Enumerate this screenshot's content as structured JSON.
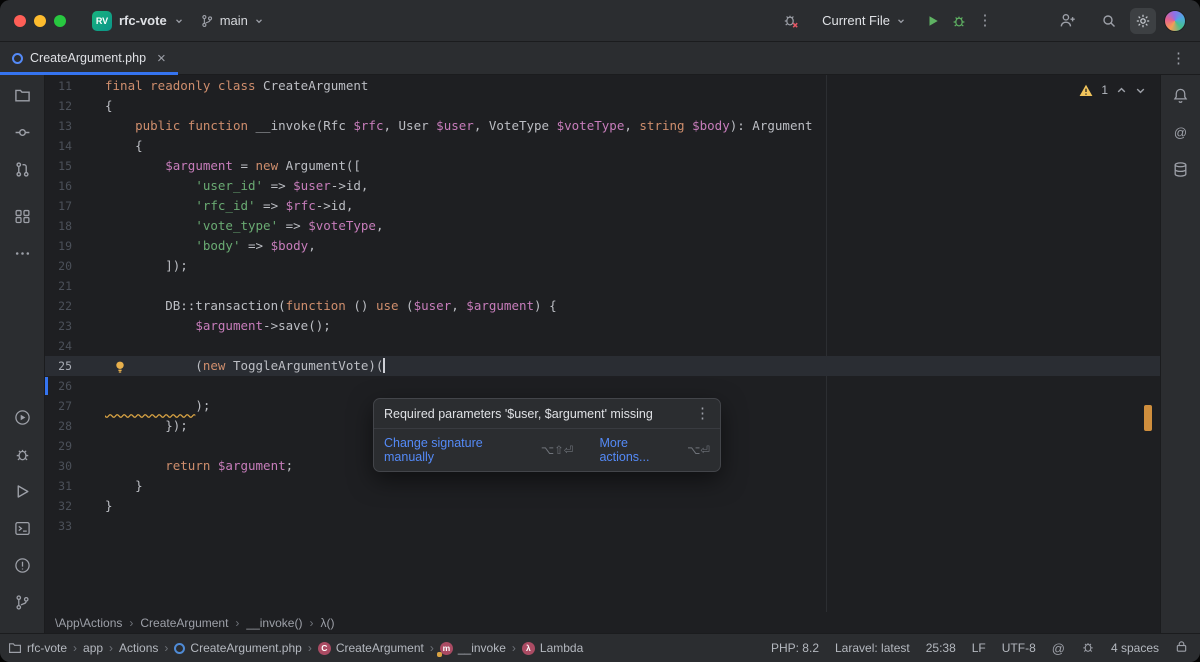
{
  "separator": "›",
  "icons": {
    "at": "@",
    "kebab": "⋮",
    "close": "×",
    "names": [
      "close-window-button",
      "minimize-window-button",
      "zoom-window-button",
      "project-logo",
      "chevron-down-icon",
      "git-branch-icon",
      "debugger-off-icon",
      "run-icon",
      "debug-icon",
      "more-vertical-icon",
      "add-user-icon",
      "search-icon",
      "gear-icon",
      "user-avatar",
      "php-file-icon",
      "bell-icon",
      "at-icon",
      "database-icon",
      "project-folder-icon",
      "commit-icon",
      "pull-request-icon",
      "structure-icon",
      "more-horizontal-icon",
      "run-circle-icon",
      "bug-icon",
      "services-icon",
      "terminal-icon",
      "problems-icon",
      "branch-icon",
      "warning-triangle-icon",
      "chevron-up-icon",
      "lightbulb-icon",
      "lock-icon"
    ]
  },
  "colors": {
    "accent_blue": "#3574f0",
    "link_blue": "#548af7",
    "keyword_orange": "#cf8e6d",
    "string_green": "#6aab73",
    "variable_purple": "#c77dbb",
    "warning_yellow": "#f2c55c",
    "run_green": "#5fb363",
    "error_stripe_orange": "#cf8e3d",
    "panel_bg": "#2b2d30",
    "editor_bg": "#1e1f22"
  },
  "titlebar": {
    "project_initials": "RV",
    "project_name": "rfc-vote",
    "branch": "main",
    "run_config": "Current File"
  },
  "tabbar": {
    "active_tab": "CreateArgument.php"
  },
  "editor": {
    "warning_count": "1",
    "lines": [
      {
        "n": "11",
        "s": [
          [
            "kw",
            "final readonly class"
          ],
          [
            "pl",
            " CreateArgument"
          ]
        ]
      },
      {
        "n": "12",
        "s": [
          [
            "pl",
            "{"
          ]
        ]
      },
      {
        "n": "13",
        "s": [
          [
            "pl",
            "    "
          ],
          [
            "kw",
            "public function "
          ],
          [
            "pl",
            "__invoke(Rfc "
          ],
          [
            "var",
            "$rfc"
          ],
          [
            "pl",
            ", User "
          ],
          [
            "var",
            "$user"
          ],
          [
            "pl",
            ", VoteType "
          ],
          [
            "var",
            "$voteType"
          ],
          [
            "pl",
            ", "
          ],
          [
            "kw",
            "string "
          ],
          [
            "var",
            "$body"
          ],
          [
            "pl",
            "): Argument"
          ]
        ]
      },
      {
        "n": "14",
        "s": [
          [
            "pl",
            "    {"
          ]
        ]
      },
      {
        "n": "15",
        "s": [
          [
            "pl",
            "        "
          ],
          [
            "var",
            "$argument"
          ],
          [
            "pl",
            " = "
          ],
          [
            "kw",
            "new"
          ],
          [
            "pl",
            " Argument(["
          ]
        ]
      },
      {
        "n": "16",
        "s": [
          [
            "pl",
            "            "
          ],
          [
            "str",
            "'user_id'"
          ],
          [
            "pl",
            " => "
          ],
          [
            "var",
            "$user"
          ],
          [
            "pl",
            "->id,"
          ]
        ]
      },
      {
        "n": "17",
        "s": [
          [
            "pl",
            "            "
          ],
          [
            "str",
            "'rfc_id'"
          ],
          [
            "pl",
            " => "
          ],
          [
            "var",
            "$rfc"
          ],
          [
            "pl",
            "->id,"
          ]
        ]
      },
      {
        "n": "18",
        "s": [
          [
            "pl",
            "            "
          ],
          [
            "str",
            "'vote_type'"
          ],
          [
            "pl",
            " => "
          ],
          [
            "var",
            "$voteType"
          ],
          [
            "pl",
            ","
          ]
        ]
      },
      {
        "n": "19",
        "s": [
          [
            "pl",
            "            "
          ],
          [
            "str",
            "'body'"
          ],
          [
            "pl",
            " => "
          ],
          [
            "var",
            "$body"
          ],
          [
            "pl",
            ","
          ]
        ]
      },
      {
        "n": "20",
        "s": [
          [
            "pl",
            "        ]);"
          ]
        ]
      },
      {
        "n": "21",
        "s": []
      },
      {
        "n": "22",
        "s": [
          [
            "pl",
            "        DB::transaction("
          ],
          [
            "kw",
            "function"
          ],
          [
            "pl",
            " () "
          ],
          [
            "kw",
            "use"
          ],
          [
            "pl",
            " ("
          ],
          [
            "var",
            "$user"
          ],
          [
            "pl",
            ", "
          ],
          [
            "var",
            "$argument"
          ],
          [
            "pl",
            ") {"
          ]
        ]
      },
      {
        "n": "23",
        "s": [
          [
            "pl",
            "            "
          ],
          [
            "var",
            "$argument"
          ],
          [
            "pl",
            "->save();"
          ]
        ]
      },
      {
        "n": "24",
        "s": []
      },
      {
        "n": "25",
        "current": true,
        "caret": true,
        "s": [
          [
            "pl",
            "            ("
          ],
          [
            "kw",
            "new"
          ],
          [
            "pl",
            " ToggleArgumentVote)("
          ]
        ]
      },
      {
        "n": "26",
        "vcs": true,
        "s": []
      },
      {
        "n": "27",
        "s": [
          [
            "wv",
            "            "
          ],
          [
            "pl",
            ");"
          ]
        ]
      },
      {
        "n": "28",
        "s": [
          [
            "pl",
            "        });"
          ]
        ]
      },
      {
        "n": "29",
        "s": []
      },
      {
        "n": "30",
        "s": [
          [
            "pl",
            "        "
          ],
          [
            "kw",
            "return"
          ],
          [
            "pl",
            " "
          ],
          [
            "var",
            "$argument"
          ],
          [
            "pl",
            ";"
          ]
        ]
      },
      {
        "n": "31",
        "s": [
          [
            "pl",
            "    }"
          ]
        ]
      },
      {
        "n": "32",
        "s": [
          [
            "pl",
            "}"
          ]
        ]
      },
      {
        "n": "33",
        "s": []
      }
    ],
    "popup": {
      "message": "Required parameters '$user, $argument' missing",
      "actions": [
        {
          "label": "Change signature manually",
          "shortcut": "⌥⇧⏎"
        },
        {
          "label": "More actions...",
          "shortcut": "⌥⏎"
        }
      ]
    },
    "crumbs": [
      "\\App\\Actions",
      "CreateArgument",
      "__invoke()",
      "λ()"
    ]
  },
  "statusbar": {
    "path": [
      {
        "label": "rfc-vote",
        "icon": "project-folder-icon"
      },
      {
        "label": "app"
      },
      {
        "label": "Actions"
      },
      {
        "label": "CreateArgument.php",
        "icon": "php-class-file-icon"
      },
      {
        "label": "CreateArgument",
        "icon": "class-icon",
        "glyph": "C"
      },
      {
        "label": "__invoke",
        "icon": "method-icon",
        "glyph": "m",
        "key": true
      },
      {
        "label": "Lambda",
        "icon": "lambda-icon",
        "glyph": "λ"
      }
    ],
    "widgets": [
      "PHP: 8.2",
      "Laravel: latest",
      "25:38",
      "LF",
      "UTF-8"
    ],
    "indent": "4 spaces"
  }
}
